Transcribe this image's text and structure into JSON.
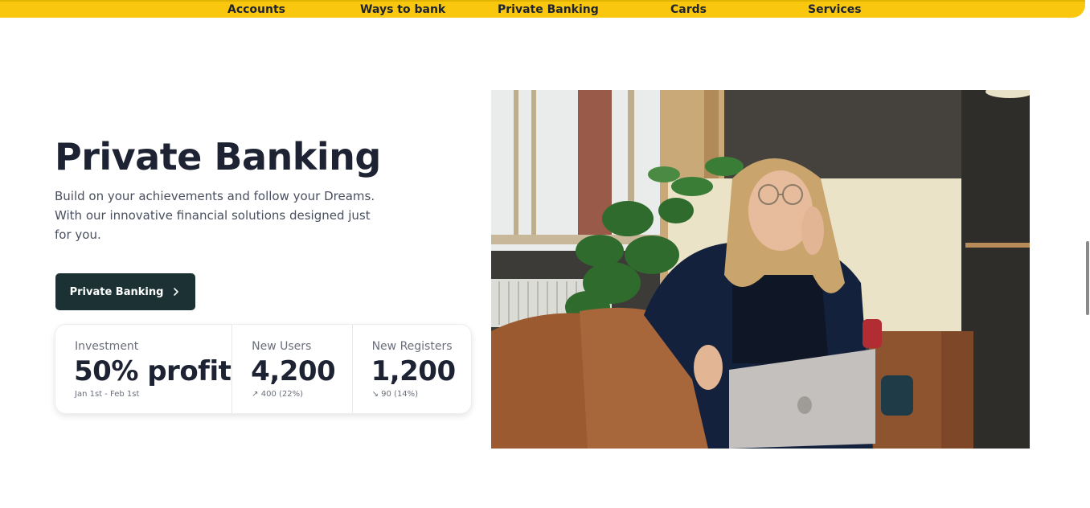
{
  "nav": {
    "items": [
      {
        "label": "Accounts"
      },
      {
        "label": "Ways to bank"
      },
      {
        "label": "Private Banking"
      },
      {
        "label": "Cards"
      },
      {
        "label": "Services"
      }
    ]
  },
  "hero": {
    "title": "Private Banking",
    "description": "Build on your achievements and follow your Dreams. With our innovative financial solutions designed just for you.",
    "cta_label": "Private Banking",
    "cta_icon": "chevron-right-icon"
  },
  "stats": [
    {
      "label": "Investment",
      "value": "50% profit",
      "sub": "Jan 1st - Feb 1st"
    },
    {
      "label": "New Users",
      "value": "4,200",
      "sub": "↗ 400 (22%)"
    },
    {
      "label": "New Registers",
      "value": "1,200",
      "sub": "↘ 90 (14%)"
    }
  ],
  "colors": {
    "nav_bg": "#f9c80e",
    "cta_bg": "#1b3133",
    "text_dark": "#1d2333"
  }
}
